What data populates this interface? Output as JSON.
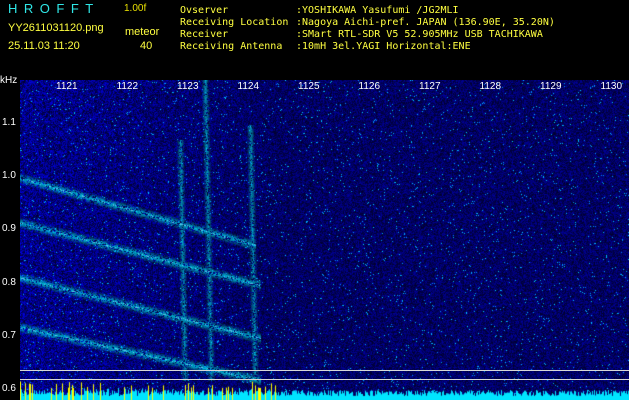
{
  "header": {
    "app_title": "HROFFT",
    "app_version": "1.00f",
    "file_name": "YY2611031120.png",
    "timestamp": "25.11.03 11:20",
    "meteor_label": "meteor",
    "meteor_count": "40"
  },
  "info": [
    {
      "key": "Ovserver",
      "value": ":YOSHIKAWA Yasufumi /JG2MLI"
    },
    {
      "key": "Receiving Location",
      "value": ":Nagoya Aichi-pref. JAPAN (136.90E, 35.20N)"
    },
    {
      "key": "Receiver",
      "value": ":SMart RTL-SDR V5 52.905MHz USB TACHIKAWA"
    },
    {
      "key": "Receiving Antenna",
      "value": ":10mH 3el.YAGI Horizontal:ENE"
    }
  ],
  "chart_data": {
    "type": "heatmap",
    "yunit": "kHz",
    "x_ticks": [
      "1121",
      "1122",
      "1123",
      "1124",
      "1125",
      "1126",
      "1127",
      "1128",
      "1129",
      "1130"
    ],
    "y_ticks": [
      "1.1",
      "1.0",
      "0.9",
      "0.8",
      "0.7",
      "0.6"
    ],
    "ylim": [
      0.58,
      1.18
    ]
  },
  "colors": {
    "background": "#000000",
    "title": "#2fe7e7",
    "text": "#ffff40",
    "noise": "#1a2aa0",
    "signal": "#5ad0ff",
    "baseline": "#00e5ff",
    "baseline_peaks": "#ffff00"
  }
}
